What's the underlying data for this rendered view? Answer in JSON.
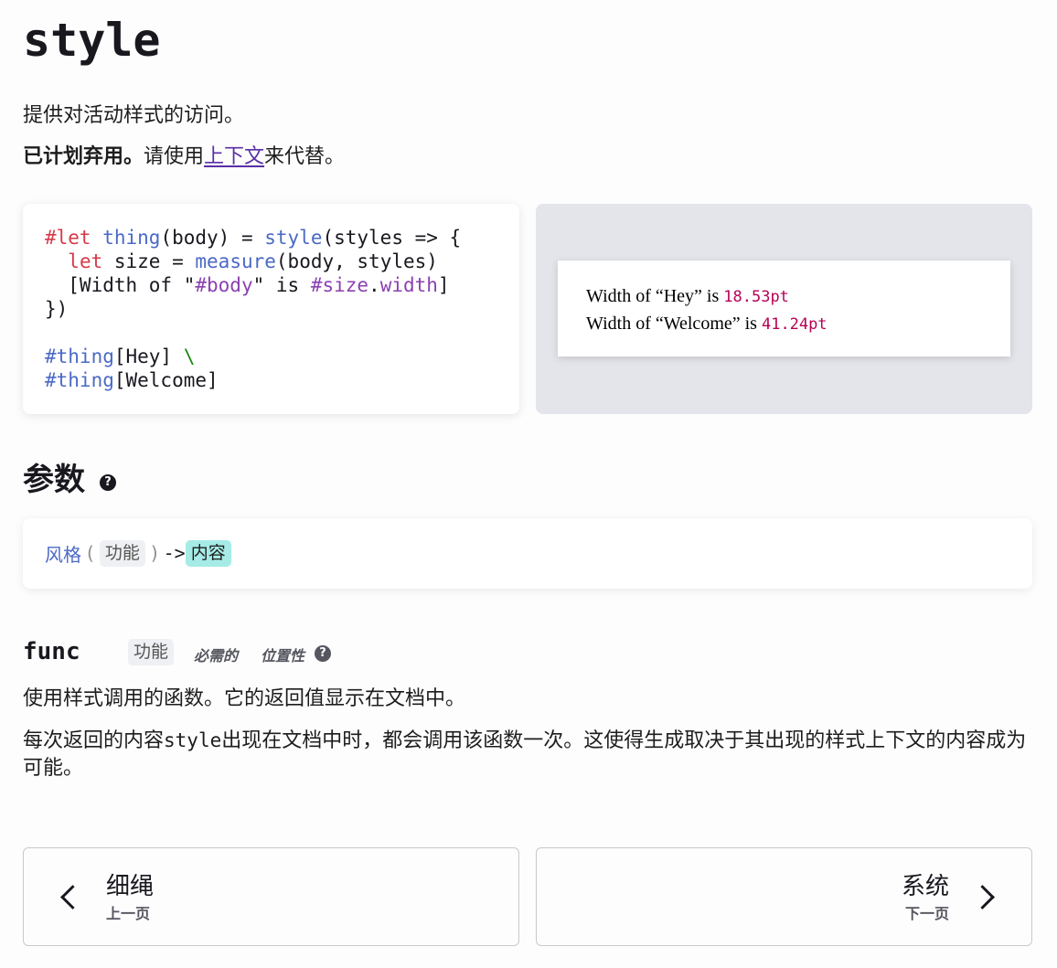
{
  "page": {
    "title": "style",
    "description": "提供对活动样式的访问。",
    "deprecation": {
      "label": "已计划弃用。",
      "before_link": "请使用",
      "link_text": "上下文",
      "after_link": "来代替。"
    }
  },
  "example": {
    "code_lines": [
      "#let thing(body) = style(styles => {",
      "  let size = measure(body, styles)",
      "  [Width of \"#body\" is #size.width]",
      "})",
      "",
      "#thing[Hey] \\",
      "#thing[Welcome]"
    ],
    "preview": {
      "line1_text": "Width of “Hey” is ",
      "line1_value": "18.53pt",
      "line2_text": "Width of “Welcome” is ",
      "line2_value": "41.24pt"
    }
  },
  "parameters": {
    "heading": "参数",
    "help_icon": "question-circle-icon",
    "signature": {
      "name": "风格",
      "open_paren": "(",
      "param_type": "功能",
      "close_paren": ")",
      "arrow": "->",
      "return_type": "内容"
    },
    "items": [
      {
        "name": "func",
        "type": "功能",
        "flag_required": "必需的",
        "flag_positional": "位置性",
        "description": "使用样式调用的函数。它的返回值显示在文档中。",
        "detail_before": "每次返回的内容",
        "detail_code": "style",
        "detail_after": "出现在文档中时，都会调用该函数一次。这使得生成取决于其出现的样式上下文的内容成为可能。"
      }
    ]
  },
  "navigation": {
    "prev": {
      "title": "细绳",
      "label": "上一页",
      "icon": "chevron-left-icon"
    },
    "next": {
      "title": "系统",
      "label": "下一页",
      "icon": "chevron-right-icon"
    }
  },
  "colors": {
    "link": "#5a2fa5",
    "keyword": "#d73a49",
    "function": "#4b69c6",
    "interpolation": "#8b41b1",
    "measured_value": "#b60157",
    "type_content_bg": "#a6ebe6",
    "type_func_bg": "#eff0f3",
    "preview_bg": "#e4e5ea"
  }
}
